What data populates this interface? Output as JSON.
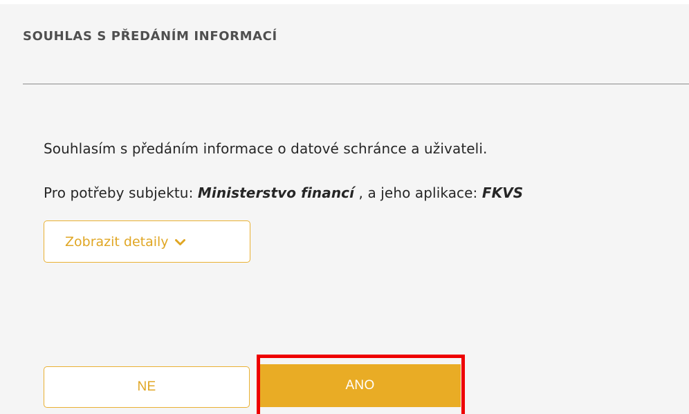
{
  "dialog": {
    "title": "SOUHLAS S PŘEDÁNÍM INFORMACÍ",
    "consent_text": "Souhlasím s předáním informace o datové schránce a uživateli.",
    "purpose_prefix": "Pro potřeby subjektu: ",
    "subject_name": "Ministerstvo financí",
    "purpose_middle": " , a jeho aplikace: ",
    "application_name": "FKVS"
  },
  "details_button": {
    "label": "Zobrazit detaily",
    "icon": "chevron-down-icon"
  },
  "actions": {
    "no_label": "NE",
    "yes_label": "ANO"
  },
  "colors": {
    "accent": "#e9ac25",
    "highlight": "#ee0000",
    "panel_bg": "#f5f5f5"
  }
}
